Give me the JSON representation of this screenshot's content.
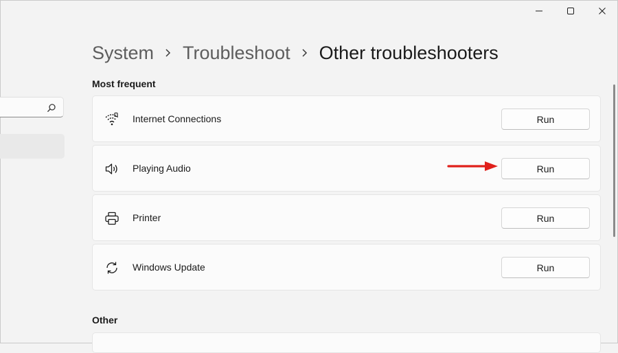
{
  "window": {
    "controls": {
      "minimize_icon": "minimize-icon",
      "maximize_icon": "maximize-icon",
      "close_icon": "close-icon"
    }
  },
  "sidebar": {
    "search": {
      "value": "",
      "icon": "search-icon"
    }
  },
  "breadcrumb": {
    "items": [
      "System",
      "Troubleshoot",
      "Other troubleshooters"
    ],
    "separator_icon": "chevron-right-icon"
  },
  "sections": {
    "most_frequent": {
      "title": "Most frequent",
      "items": [
        {
          "label": "Internet Connections",
          "icon": "wifi-icon",
          "button_label": "Run"
        },
        {
          "label": "Playing Audio",
          "icon": "speaker-icon",
          "button_label": "Run"
        },
        {
          "label": "Printer",
          "icon": "printer-icon",
          "button_label": "Run"
        },
        {
          "label": "Windows Update",
          "icon": "sync-icon",
          "button_label": "Run"
        }
      ]
    },
    "other": {
      "title": "Other"
    }
  },
  "colors": {
    "background": "#f3f3f3",
    "card": "#fbfbfb",
    "annotation_arrow": "#e0201b"
  }
}
